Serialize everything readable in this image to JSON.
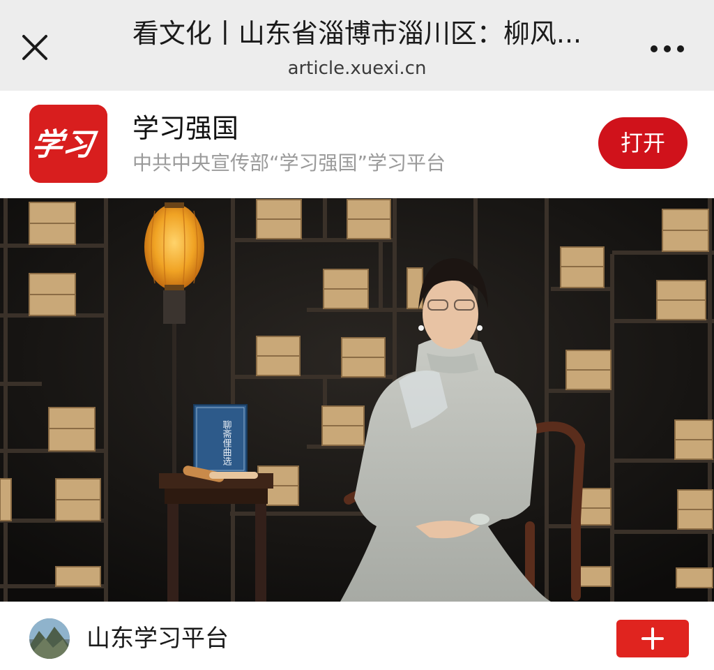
{
  "browser": {
    "title": "看文化丨山东省淄博市淄川区：柳风...",
    "domain": "article.xuexi.cn",
    "close_icon": "close-icon",
    "more_icon": "more-horizontal-icon"
  },
  "app_banner": {
    "logo_text": "学习",
    "name": "学习强国",
    "description": "中共中央宣传部“学习强国”学习平台",
    "open_button": "打开",
    "brand_color": "#d0121b"
  },
  "video": {
    "book_title": "聊斋俚曲选"
  },
  "footer": {
    "account_name": "山东学习平台",
    "follow_icon": "plus-icon",
    "follow_color": "#e0241f"
  }
}
